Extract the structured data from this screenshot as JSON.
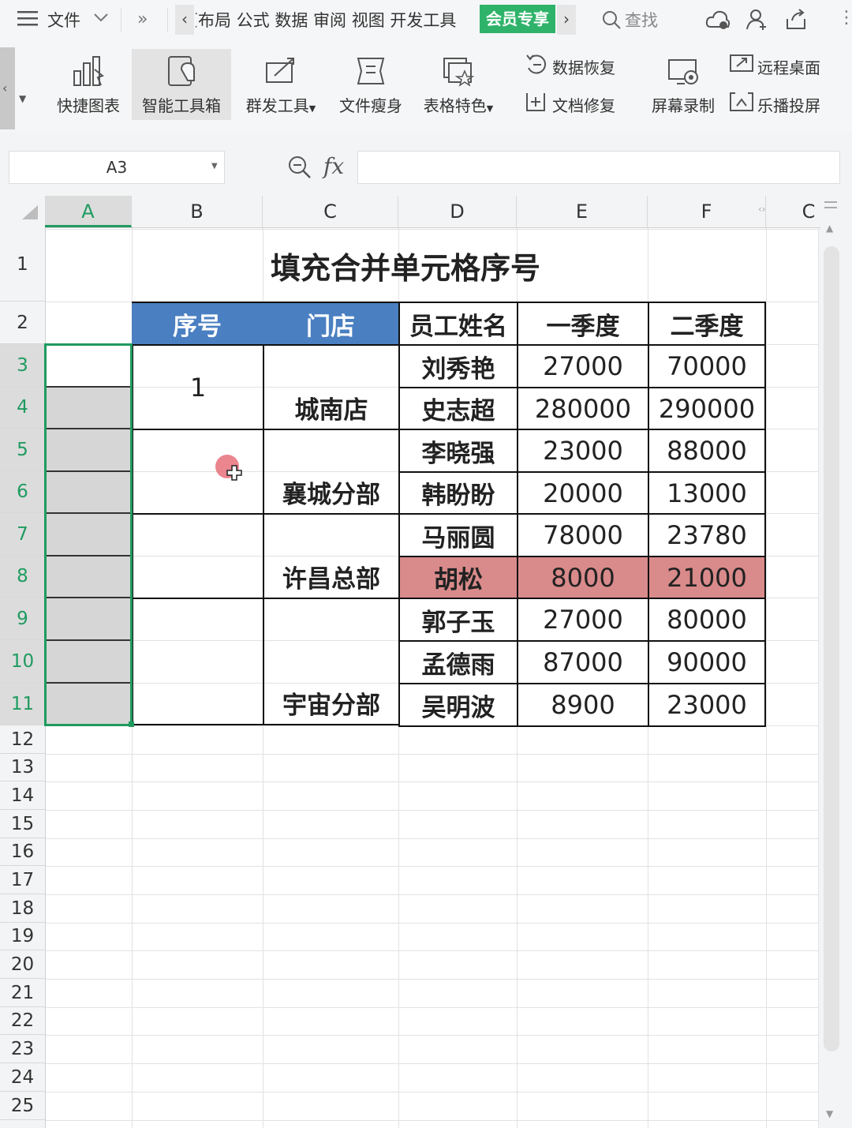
{
  "topbar": {
    "menu": "文件",
    "tabs": "局 公式 数据 审阅 视图 开发工具",
    "tab_partial": "页布",
    "member": "会员专享",
    "search": "查找"
  },
  "ribbon": {
    "quick_chart": "快捷图表",
    "smart_toolbox": "智能工具箱",
    "bulk_send": "群发工具",
    "file_slim": "文件瘦身",
    "table_special": "表格特色",
    "data_recovery": "数据恢复",
    "doc_repair": "文档修复",
    "screen_record": "屏幕录制",
    "remote_desktop": "远程桌面",
    "cast_screen": "乐播投屏"
  },
  "formula_bar": {
    "cell_ref": "A3",
    "fx": "fx"
  },
  "columns": [
    "A",
    "B",
    "C",
    "D",
    "E",
    "F",
    "C"
  ],
  "rows": [
    "1",
    "2",
    "3",
    "4",
    "5",
    "6",
    "7",
    "8",
    "9",
    "10",
    "11",
    "12",
    "13",
    "14",
    "15",
    "16",
    "17",
    "18",
    "19",
    "20",
    "21",
    "22",
    "23",
    "24",
    "25"
  ],
  "sheet": {
    "title": "填充合并单元格序号",
    "headers": [
      "序号",
      "门店",
      "员工姓名",
      "一季度",
      "二季度"
    ],
    "serial_1": "1",
    "stores": [
      "城南店",
      "襄城分部",
      "许昌总部",
      "宇宙分部"
    ],
    "records": [
      [
        "刘秀艳",
        "27000",
        "70000"
      ],
      [
        "史志超",
        "280000",
        "290000"
      ],
      [
        "李晓强",
        "23000",
        "88000"
      ],
      [
        "韩盼盼",
        "20000",
        "13000"
      ],
      [
        "马丽圆",
        "78000",
        "23780"
      ],
      [
        "胡松",
        "8000",
        "21000"
      ],
      [
        "郭子玉",
        "27000",
        "80000"
      ],
      [
        "孟德雨",
        "87000",
        "90000"
      ],
      [
        "吴明波",
        "8900",
        "23000"
      ]
    ]
  },
  "colors": {
    "header_blue": "#4a7fc1",
    "highlight_pink": "#d98a8a",
    "select_green": "#1f9b60",
    "member_green": "#2fb36a"
  }
}
